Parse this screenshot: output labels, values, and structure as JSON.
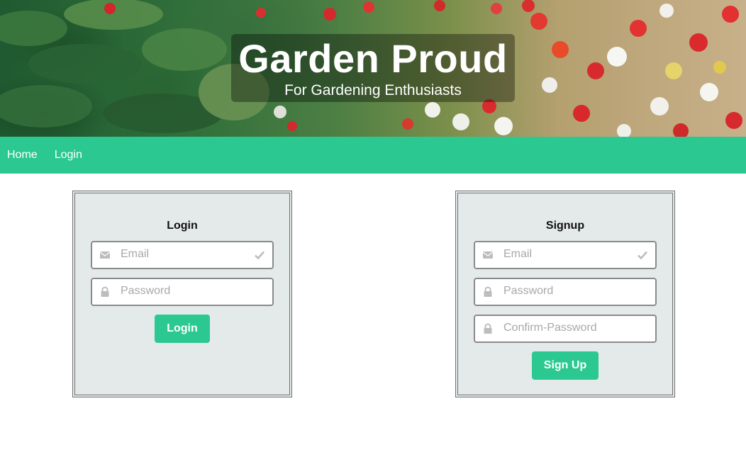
{
  "hero": {
    "title": "Garden Proud",
    "subtitle": "For Gardening Enthusiasts"
  },
  "nav": {
    "items": [
      {
        "label": "Home"
      },
      {
        "label": "Login"
      }
    ]
  },
  "login": {
    "title": "Login",
    "email_placeholder": "Email",
    "password_placeholder": "Password",
    "button_label": "Login"
  },
  "signup": {
    "title": "Signup",
    "email_placeholder": "Email",
    "password_placeholder": "Password",
    "confirm_placeholder": "Confirm-Password",
    "button_label": "Sign Up"
  },
  "colors": {
    "accent": "#2bc991",
    "panel_bg": "#e4eaea",
    "field_border": "#8a8a8a",
    "icon": "#bdbdbd"
  },
  "icons": {
    "email": "envelope-icon",
    "valid": "checkmark-icon",
    "password": "lock-icon"
  }
}
